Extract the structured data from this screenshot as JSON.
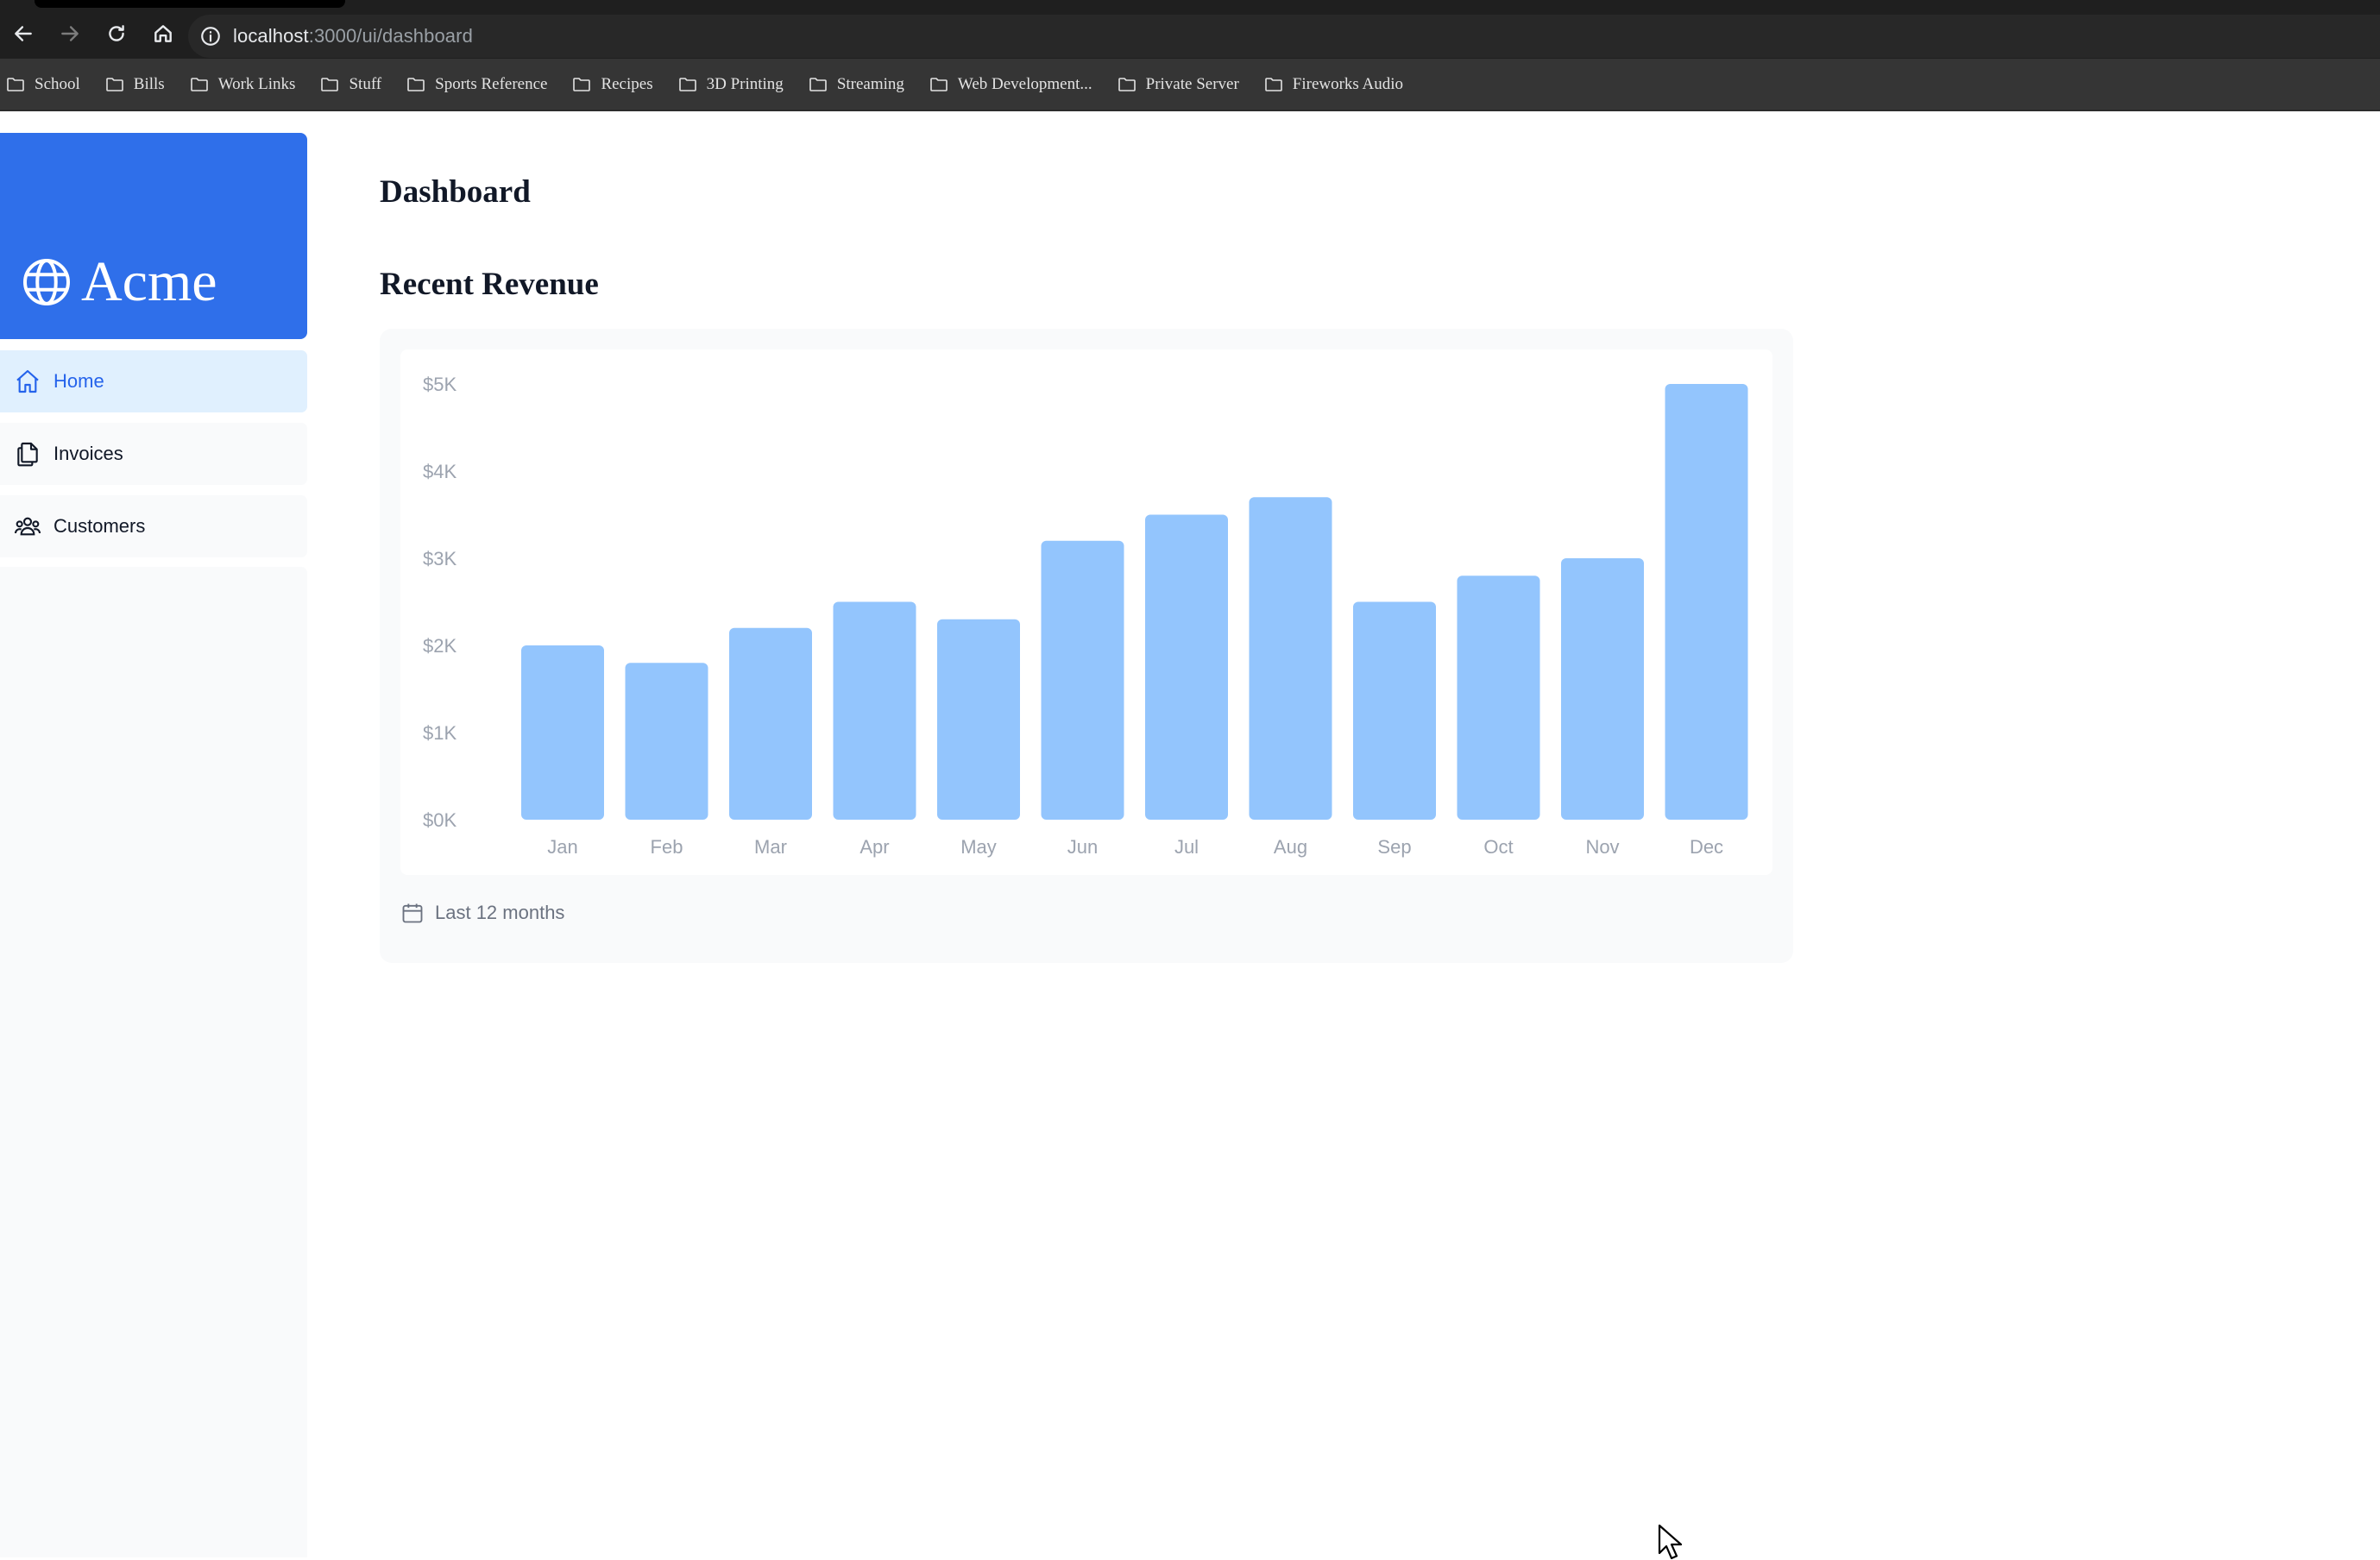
{
  "browser": {
    "url_host": "localhost",
    "url_path": ":3000/ui/dashboard",
    "bookmarks": [
      {
        "label": "School"
      },
      {
        "label": "Bills"
      },
      {
        "label": "Work Links"
      },
      {
        "label": "Stuff"
      },
      {
        "label": "Sports Reference"
      },
      {
        "label": "Recipes"
      },
      {
        "label": "3D Printing"
      },
      {
        "label": "Streaming"
      },
      {
        "label": "Web Development..."
      },
      {
        "label": "Private Server"
      },
      {
        "label": "Fireworks Audio"
      }
    ]
  },
  "sidebar": {
    "logo_text": "Acme",
    "items": [
      {
        "label": "Home",
        "icon": "home-icon",
        "active": true
      },
      {
        "label": "Invoices",
        "icon": "documents-icon",
        "active": false
      },
      {
        "label": "Customers",
        "icon": "users-icon",
        "active": false
      }
    ]
  },
  "main": {
    "title": "Dashboard",
    "section_title": "Recent Revenue",
    "footer_label": "Last 12 months"
  },
  "colors": {
    "brand": "#2f6fea",
    "bar": "#93c5fd",
    "active_nav_bg": "#e0f0fe",
    "active_nav_text": "#2563eb"
  },
  "chart_data": {
    "type": "bar",
    "title": "",
    "xlabel": "",
    "ylabel": "",
    "categories": [
      "Jan",
      "Feb",
      "Mar",
      "Apr",
      "May",
      "Jun",
      "Jul",
      "Aug",
      "Sep",
      "Oct",
      "Nov",
      "Dec"
    ],
    "values": [
      2000,
      1800,
      2200,
      2500,
      2300,
      3200,
      3500,
      3700,
      2500,
      2800,
      3000,
      5000
    ],
    "ylim": [
      0,
      5000
    ],
    "y_ticks": [
      "$0K",
      "$1K",
      "$2K",
      "$3K",
      "$4K",
      "$5K"
    ],
    "grid": false,
    "legend": "none"
  }
}
